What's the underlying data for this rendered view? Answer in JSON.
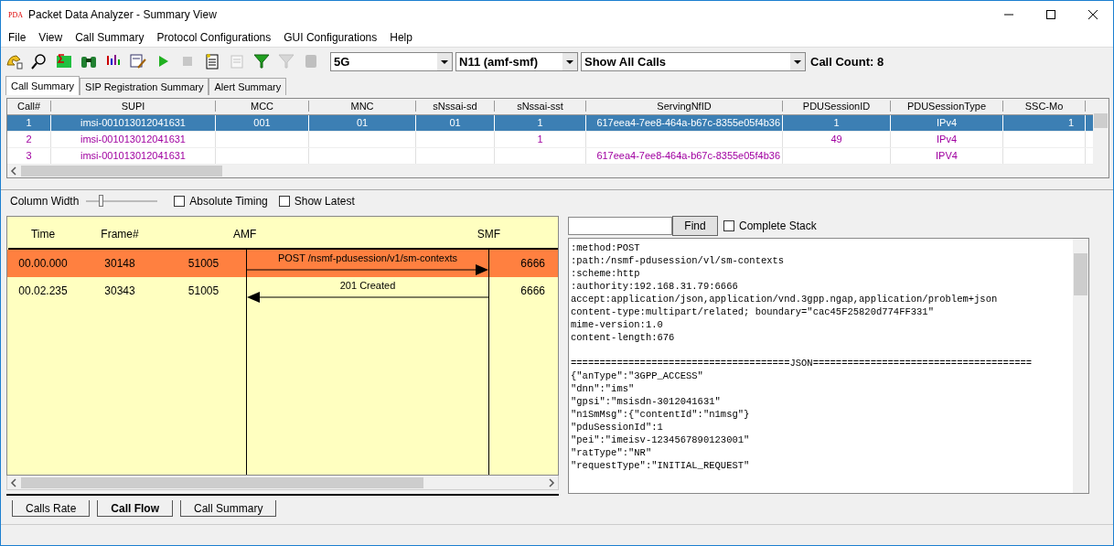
{
  "window": {
    "logo": "PDA",
    "title": "Packet Data Analyzer - Summary View"
  },
  "menu": [
    "File",
    "View",
    "Call Summary",
    "Protocol Configurations",
    "GUI Configurations",
    "Help"
  ],
  "toolbar": {
    "tools": [
      {
        "disabled": false
      },
      {
        "disabled": false
      },
      {
        "disabled": false
      },
      {
        "disabled": false
      },
      {
        "disabled": false
      },
      {
        "disabled": false
      },
      {
        "disabled": false
      },
      {
        "disabled": true
      },
      {
        "disabled": false
      },
      {
        "disabled": true
      },
      {
        "disabled": false
      },
      {
        "disabled": true
      },
      {
        "disabled": true
      }
    ],
    "dropdowns": [
      "5G",
      "N11 (amf-smf)",
      "Show All Calls"
    ],
    "call_count": "Call Count: 8"
  },
  "tabs": [
    {
      "label": "Call Summary",
      "selected": true
    },
    {
      "label": "SIP Registration Summary",
      "selected": false
    },
    {
      "label": "Alert Summary",
      "selected": false
    }
  ],
  "table": {
    "columns": [
      "Call#",
      "SUPI",
      "MCC",
      "MNC",
      "sNssai-sd",
      "sNssai-sst",
      "ServingNfID",
      "PDUSessionID",
      "PDUSessionType",
      "SSC-Mo"
    ],
    "rows": [
      {
        "selected": true,
        "cells": [
          "1",
          "imsi-001013012041631",
          "001",
          "01",
          "01",
          "1",
          "617eea4-7ee8-464a-b67c-8355e05f4b36",
          "1",
          "IPv4",
          "1"
        ]
      },
      {
        "selected": false,
        "cells": [
          "2",
          "imsi-001013012041631",
          null,
          null,
          null,
          "1",
          null,
          "49",
          "IPv4",
          null
        ]
      },
      {
        "selected": false,
        "cells": [
          "3",
          "imsi-001013012041631",
          null,
          null,
          null,
          null,
          "617eea4-7ee8-464a-b67c-8355e05f4b36",
          null,
          "IPV4",
          null
        ]
      }
    ]
  },
  "flow_controls": {
    "slider_label": "Column Width",
    "level": 0.17,
    "checkboxes": [
      {
        "label": "Absolute Timing",
        "checked": false
      },
      {
        "label": "Show Latest",
        "checked": false
      }
    ]
  },
  "call_flow": {
    "columns": [
      "Time",
      "Frame#",
      "AMF",
      "SMF"
    ],
    "messages": [
      {
        "time": "00.00.000",
        "frame": "30148",
        "src_port": "51005",
        "label": "POST /nsmf-pdusession/v1/sm-contexts",
        "kind": "request",
        "dst_port": "6666",
        "selected": true
      },
      {
        "time": "00.02.235",
        "frame": "30343",
        "src_port": "51005",
        "label": "201 Created",
        "kind": "response",
        "dst_port": "6666",
        "selected": false
      }
    ]
  },
  "detail": {
    "find_button": "Find",
    "complete_stack": {
      "label": "Complete Stack",
      "checked": false
    },
    "headers": [
      ":method:POST",
      ":path:/nsmf-pdusession/vl/sm-contexts",
      ":scheme:http",
      ":authority:192.168.31.79:6666",
      "accept:application/json,application/vnd.3gpp.ngap,application/problem+json",
      "content-type:multipart/related; boundary=\"cac45F25820d774FF331\"",
      "mime-version:1.0",
      "content-length:676"
    ],
    "separator": "======================================JSON======================================",
    "json_lines": [
      "{\"anType\":\"3GPP_ACCESS\"",
      "\"dnn\":\"ims\"",
      "\"gpsi\":\"msisdn-3012041631\"",
      "\"n1SmMsg\":{\"contentId\":\"n1msg\"}",
      "\"pduSessionId\":1",
      "\"pei\":\"imeisv-1234567890123001\"",
      "\"ratType\":\"NR\"",
      "\"requestType\":\"INITIAL_REQUEST\""
    ]
  },
  "bottom_tabs": [
    {
      "label": "Calls Rate",
      "selected": false
    },
    {
      "label": "Call Flow",
      "selected": true
    },
    {
      "label": "Call Summary",
      "selected": false
    }
  ]
}
